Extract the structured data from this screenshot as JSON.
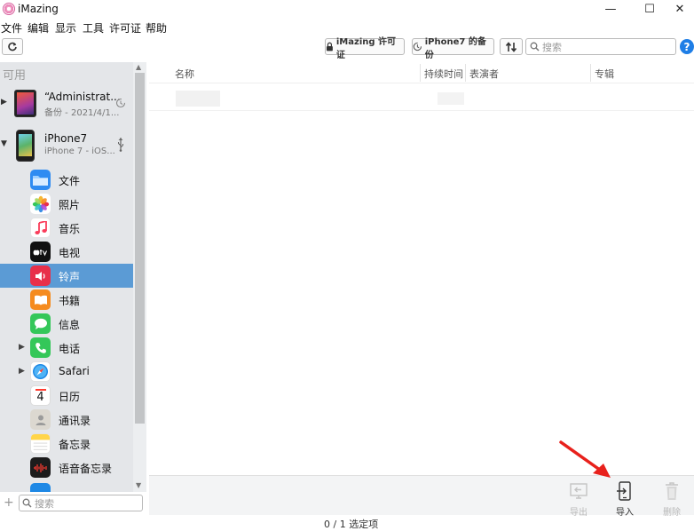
{
  "window": {
    "title": "iMazing",
    "minimize": "—",
    "maximize": "☐",
    "close": "✕"
  },
  "menubar": [
    "文件",
    "编辑",
    "显示",
    "工具",
    "许可证",
    "帮助"
  ],
  "toolbar": {
    "license_label": "iMazing 许可证",
    "backup_label": "iPhone7 的备份",
    "search_placeholder": "搜索",
    "help_label": "?"
  },
  "sidebar": {
    "section_label": "可用",
    "devices": [
      {
        "name": "“Administrat...",
        "sub": "备份 - 2021/4/1...",
        "icon": "history-icon"
      },
      {
        "name": "iPhone7",
        "sub": "iPhone 7 - iOS...",
        "icon": "usb-icon"
      }
    ],
    "apps": [
      {
        "label": "文件",
        "icon": "folder-icon",
        "color": "#2f8cf2"
      },
      {
        "label": "照片",
        "icon": "photos-icon",
        "color": "#f7b733"
      },
      {
        "label": "音乐",
        "icon": "music-icon",
        "color": "#fa3c5a"
      },
      {
        "label": "电视",
        "icon": "tv-icon",
        "color": "#111111"
      },
      {
        "label": "铃声",
        "icon": "ringtone-icon",
        "color": "#e8304a"
      },
      {
        "label": "书籍",
        "icon": "books-icon",
        "color": "#f58b1f"
      },
      {
        "label": "信息",
        "icon": "messages-icon",
        "color": "#34c759"
      },
      {
        "label": "电话",
        "icon": "phone-icon",
        "color": "#34c759"
      },
      {
        "label": "Safari",
        "icon": "safari-icon",
        "color": "#1e88e5"
      },
      {
        "label": "日历",
        "icon": "calendar-icon",
        "color": "#ffffff"
      },
      {
        "label": "通讯录",
        "icon": "contacts-icon",
        "color": "#c8c8c8"
      },
      {
        "label": "备忘录",
        "icon": "notes-icon",
        "color": "#ffd54a"
      },
      {
        "label": "语音备忘录",
        "icon": "voice-memo-icon",
        "color": "#1c1c1c"
      }
    ],
    "selected_app": "铃声",
    "calendar_day": "4",
    "search_placeholder": "搜索",
    "add_label": "+"
  },
  "table": {
    "columns": [
      "名称",
      "持续时间",
      "表演者",
      "专辑"
    ]
  },
  "actions": [
    {
      "label": "导出",
      "enabled": false,
      "icon": "export-icon"
    },
    {
      "label": "导入",
      "enabled": true,
      "icon": "import-icon"
    },
    {
      "label": "删除",
      "enabled": false,
      "icon": "trash-icon"
    }
  ],
  "status": "0 / 1 选定项"
}
